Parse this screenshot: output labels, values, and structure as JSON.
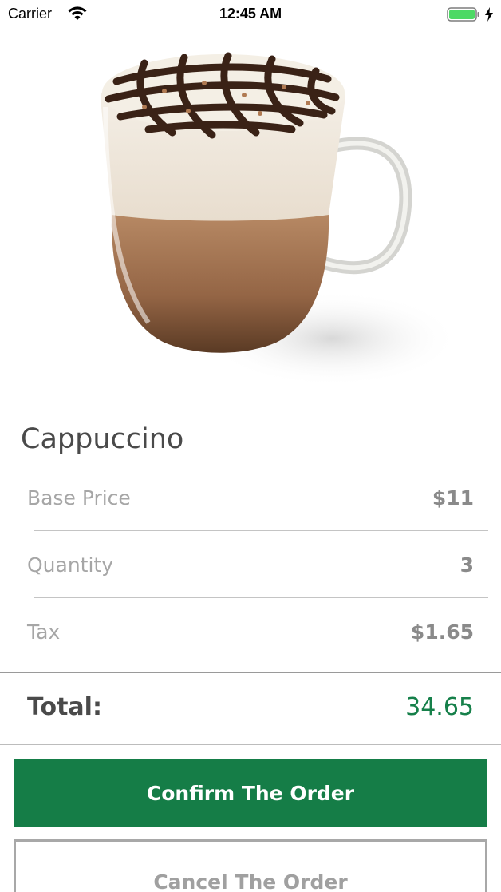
{
  "status_bar": {
    "carrier": "Carrier",
    "time": "12:45 AM",
    "battery_color": "#4cd964"
  },
  "product": {
    "name": "Cappuccino",
    "image_icon": "cappuccino-mug-image"
  },
  "details": [
    {
      "label": "Base Price",
      "value": "$11"
    },
    {
      "label": "Quantity",
      "value": "3"
    },
    {
      "label": "Tax",
      "value": "$1.65"
    }
  ],
  "total": {
    "label": "Total:",
    "value": "34.65"
  },
  "actions": {
    "confirm_label": "Confirm The Order",
    "cancel_label": "Cancel The Order"
  },
  "colors": {
    "accent": "#157d47",
    "total_value": "#16804a",
    "muted_text": "#a6a6a6"
  }
}
